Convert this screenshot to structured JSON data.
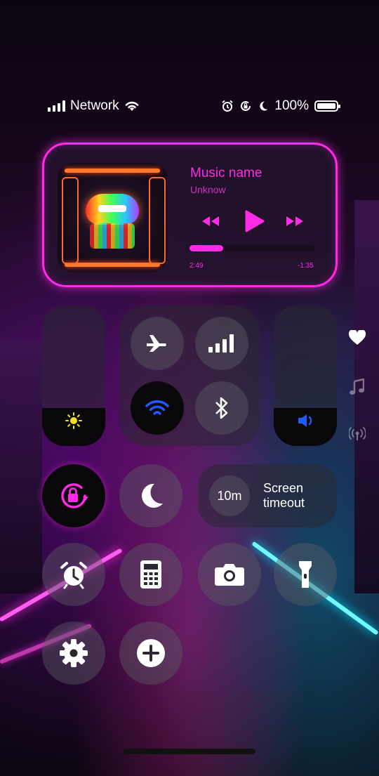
{
  "status_bar": {
    "network_label": "Network",
    "battery": "100%",
    "icons": [
      "signal-icon",
      "wifi-icon",
      "alarm-icon",
      "rotation-lock-icon",
      "moon-icon",
      "battery-icon"
    ]
  },
  "media": {
    "title": "Music name",
    "artist": "Unknow",
    "elapsed": "2:49",
    "remaining": "-1:35",
    "progress_fraction": 0.27,
    "accent_color": "#ff2be6"
  },
  "controls": {
    "airplane": "airplane-icon",
    "cellular": "cellular-data-icon",
    "wifi": "wifi-icon",
    "bluetooth": "bluetooth-icon",
    "brightness_level": 0.27,
    "volume_level": 0.27,
    "timeout_value": "10m",
    "timeout_label_line1": "Screen",
    "timeout_label_line2": "timeout"
  },
  "shortcuts": [
    "alarm-icon",
    "calculator-icon",
    "camera-icon",
    "flashlight-icon",
    "settings-icon",
    "add-icon"
  ],
  "side_icons": [
    "heart-icon",
    "music-note-icon",
    "broadcast-icon"
  ],
  "colors": {
    "wifi_active": "#1e5bff",
    "volume_active": "#1e5bff",
    "brightness": "#f3e21a",
    "rotation": "#ff2be6"
  }
}
